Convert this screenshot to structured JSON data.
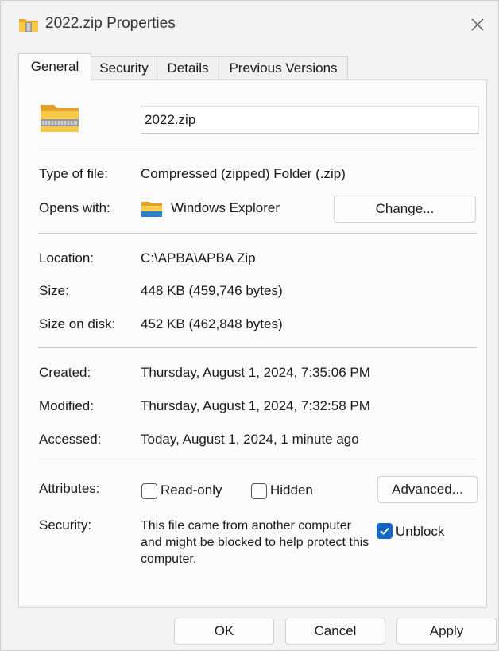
{
  "window": {
    "title": "2022.zip Properties",
    "close_icon": "close-icon"
  },
  "tabs": [
    {
      "label": "General",
      "active": true
    },
    {
      "label": "Security",
      "active": false
    },
    {
      "label": "Details",
      "active": false
    },
    {
      "label": "Previous Versions",
      "active": false
    }
  ],
  "general": {
    "file_name": "2022.zip",
    "type_label": "Type of file:",
    "type_value": "Compressed (zipped) Folder (.zip)",
    "opens_label": "Opens with:",
    "opens_value": "Windows Explorer",
    "change_button": "Change...",
    "location_label": "Location:",
    "location_value": "C:\\APBA\\APBA Zip",
    "size_label": "Size:",
    "size_value": "448 KB (459,746 bytes)",
    "size_on_disk_label": "Size on disk:",
    "size_on_disk_value": "452 KB (462,848 bytes)",
    "created_label": "Created:",
    "created_value": "Thursday, August 1, 2024, 7:35:06 PM",
    "modified_label": "Modified:",
    "modified_value": "Thursday, August 1, 2024, 7:32:58 PM",
    "accessed_label": "Accessed:",
    "accessed_value": "Today, August 1, 2024, 1 minute ago",
    "attributes_label": "Attributes:",
    "readonly_label": "Read-only",
    "readonly_checked": false,
    "hidden_label": "Hidden",
    "hidden_checked": false,
    "advanced_button": "Advanced...",
    "security_label": "Security:",
    "security_text": "This file came from another computer and might be blocked to help protect this computer.",
    "unblock_label": "Unblock",
    "unblock_checked": true
  },
  "footer": {
    "ok": "OK",
    "cancel": "Cancel",
    "apply": "Apply"
  },
  "colors": {
    "accent": "#1466c0",
    "folder": "#f2c233"
  }
}
